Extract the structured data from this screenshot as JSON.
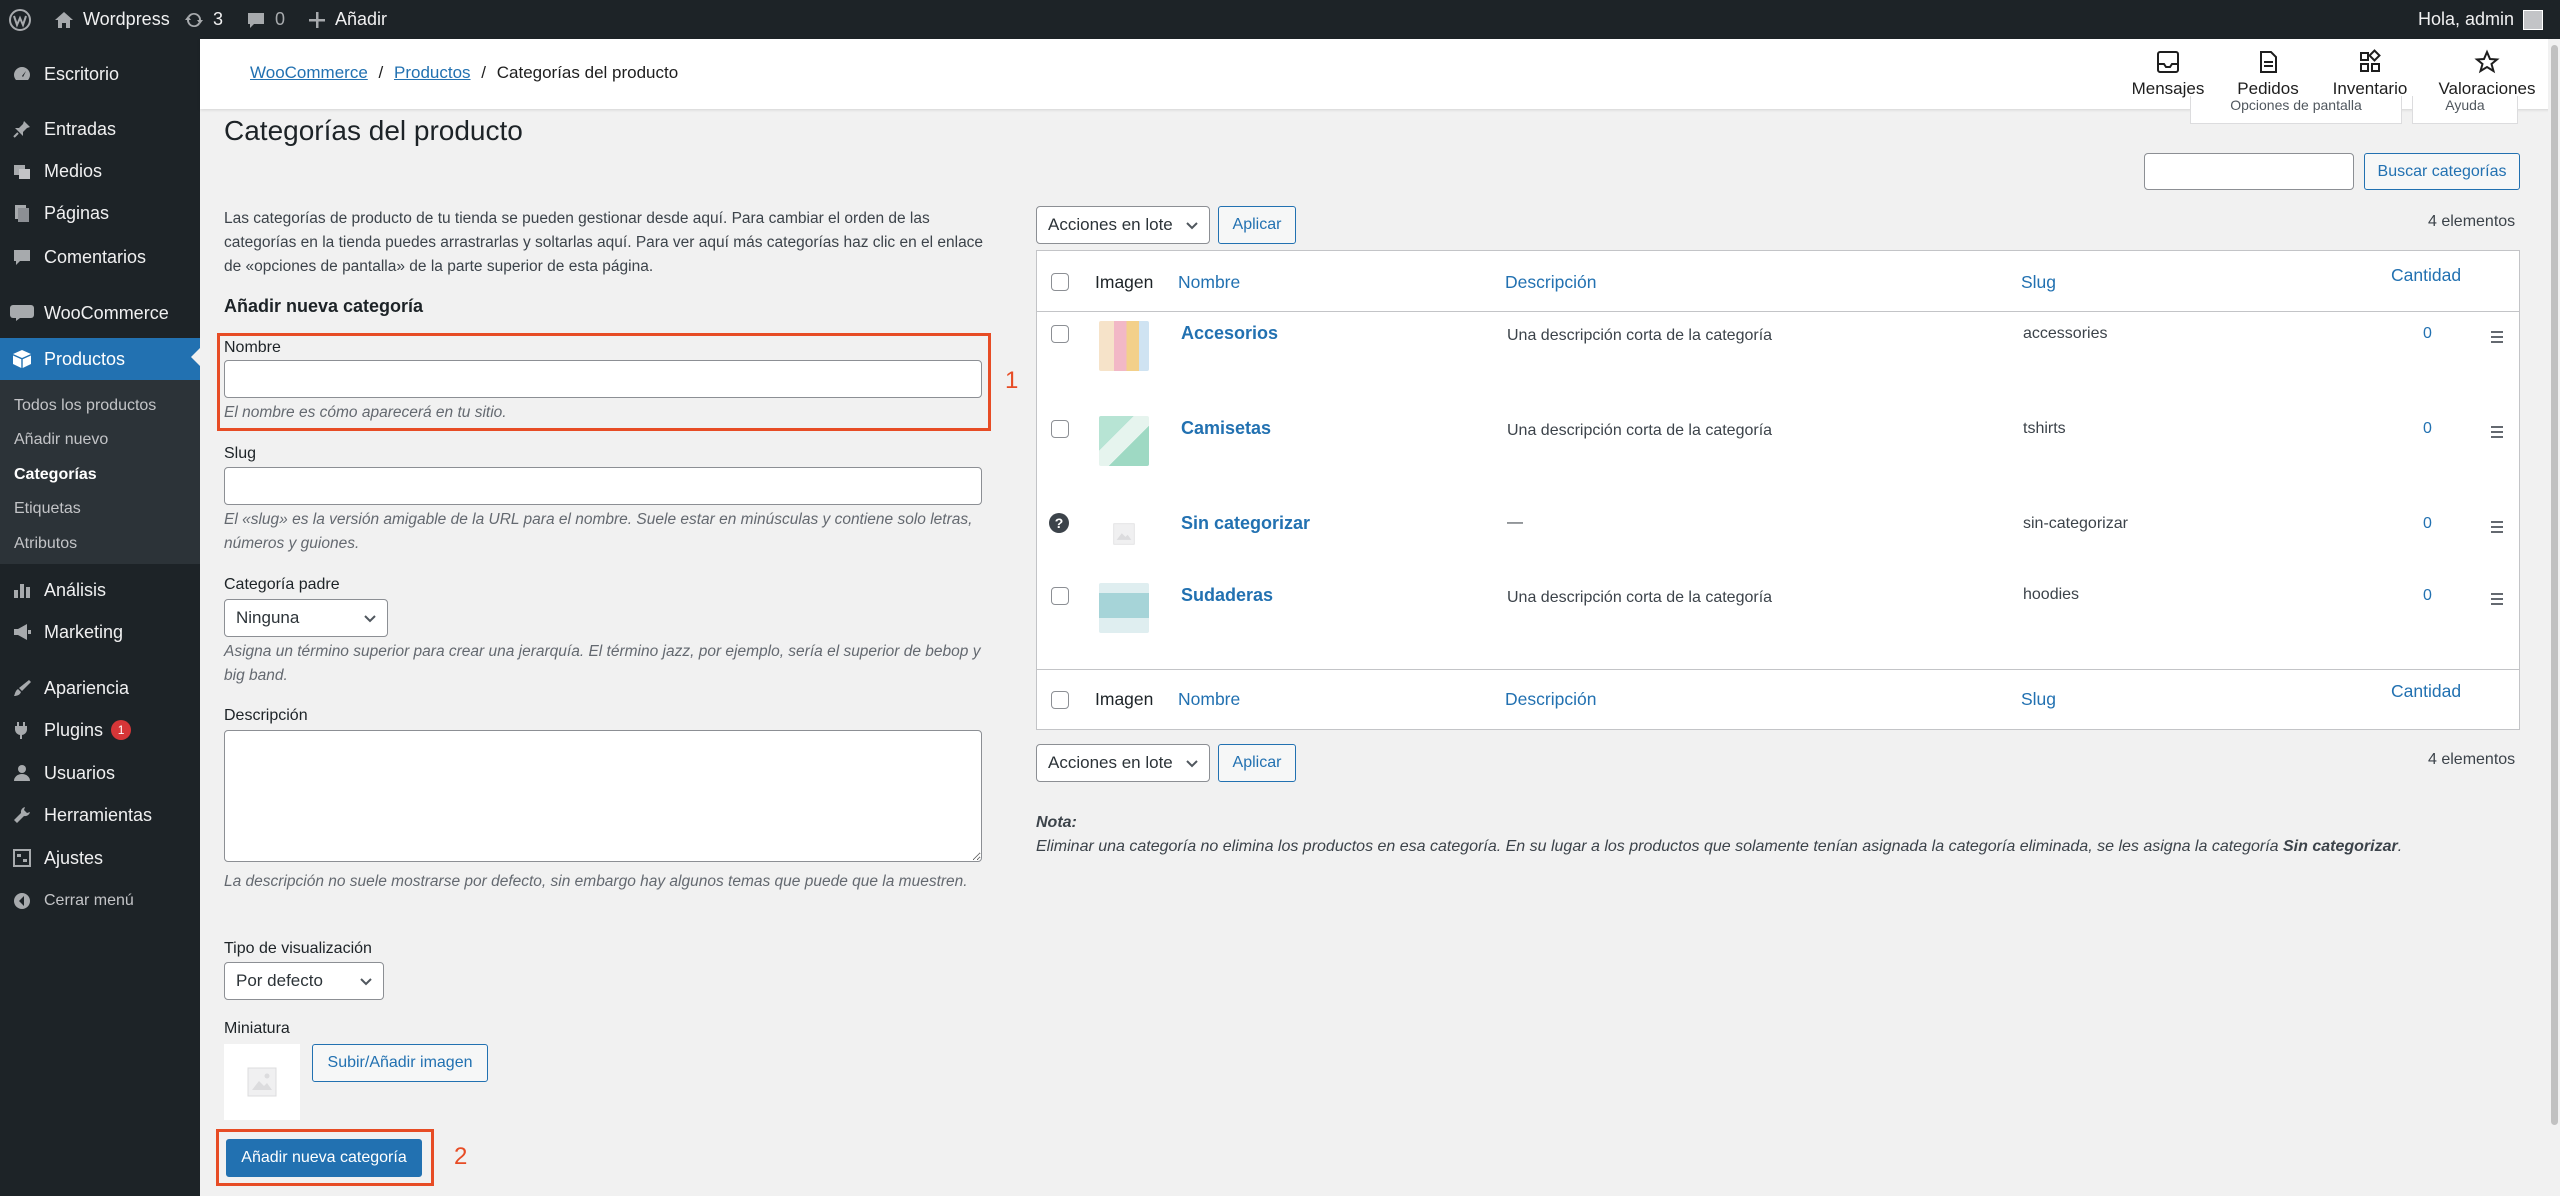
{
  "adminbar": {
    "site_name": "Wordpress",
    "updates_count": "3",
    "comments_count": "0",
    "add_new": "Añadir",
    "greeting": "Hola, admin"
  },
  "sidebar": {
    "items": {
      "dashboard": "Escritorio",
      "posts": "Entradas",
      "media": "Medios",
      "pages": "Páginas",
      "comments": "Comentarios",
      "woocommerce": "WooCommerce",
      "products": "Productos",
      "analytics": "Análisis",
      "marketing": "Marketing",
      "appearance": "Apariencia",
      "plugins": "Plugins",
      "users": "Usuarios",
      "tools": "Herramientas",
      "settings": "Ajustes",
      "collapse": "Cerrar menú"
    },
    "plugins_badge": "1",
    "submenu": {
      "all_products": "Todos los productos",
      "add_new": "Añadir nuevo",
      "categories": "Categorías",
      "tags": "Etiquetas",
      "attributes": "Atributos"
    }
  },
  "header": {
    "breadcrumb": {
      "woocommerce": "WooCommerce",
      "sep": "/",
      "products": "Productos",
      "current": "Categorías del producto"
    },
    "actions": {
      "messages": "Mensajes",
      "orders": "Pedidos",
      "inventory": "Inventario",
      "reviews": "Valoraciones"
    },
    "screen_options": "Opciones de pantalla",
    "help": "Ayuda"
  },
  "page": {
    "title": "Categorías del producto",
    "intro": "Las categorías de producto de tu tienda se pueden gestionar desde aquí. Para cambiar el orden de las categorías en la tienda puedes arrastrarlas y soltarlas aquí. Para ver aquí más categorías haz clic en el enlace de «opciones de pantalla» de la parte superior de esta página."
  },
  "form": {
    "heading": "Añadir nueva categoría",
    "name_label": "Nombre",
    "name_value": "",
    "name_help": "El nombre es cómo aparecerá en tu sitio.",
    "slug_label": "Slug",
    "slug_value": "",
    "slug_help": "El «slug» es la versión amigable de la URL para el nombre. Suele estar en minúsculas y contiene solo letras, números y guiones.",
    "parent_label": "Categoría padre",
    "parent_value": "Ninguna",
    "parent_help": "Asigna un término superior para crear una jerarquía. El término jazz, por ejemplo, sería el superior de bebop y big band.",
    "description_label": "Descripción",
    "description_value": "",
    "description_help": "La descripción no suele mostrarse por defecto, sin embargo hay algunos temas que puede que la muestren.",
    "display_type_label": "Tipo de visualización",
    "display_type_value": "Por defecto",
    "thumbnail_label": "Miniatura",
    "upload_button": "Subir/Añadir imagen",
    "submit_button": "Añadir nueva categoría",
    "annotation_1": "1",
    "annotation_2": "2"
  },
  "table": {
    "search_placeholder": "",
    "search_button": "Buscar categorías",
    "bulk_actions": "Acciones en lote",
    "apply": "Aplicar",
    "item_count": "4 elementos",
    "columns": {
      "image": "Imagen",
      "name": "Nombre",
      "description": "Descripción",
      "slug": "Slug",
      "count": "Cantidad"
    },
    "rows": [
      {
        "name": "Accesorios",
        "description": "Una descripción corta de la categoría",
        "slug": "accessories",
        "count": "0"
      },
      {
        "name": "Camisetas",
        "description": "Una descripción corta de la categoría",
        "slug": "tshirts",
        "count": "0"
      },
      {
        "name": "Sin categorizar",
        "description": "—",
        "slug": "sin-categorizar",
        "count": "0"
      },
      {
        "name": "Sudaderas",
        "description": "Una descripción corta de la categoría",
        "slug": "hoodies",
        "count": "0"
      }
    ],
    "note_label": "Nota:",
    "note_text_before": "Eliminar una categoría no elimina los productos en esa categoría. En su lugar a los productos que solamente tenían asignada la categoría eliminada, se les asigna la categoría ",
    "note_bold": "Sin categorizar",
    "note_end": "."
  },
  "colors": {
    "accent": "#2271b1",
    "admin_dark": "#1d2327",
    "highlight": "#e74c25"
  }
}
